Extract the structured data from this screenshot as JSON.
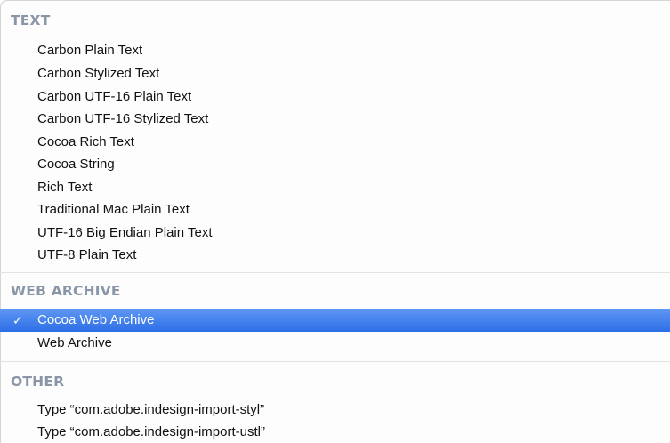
{
  "sections": [
    {
      "header": "TEXT",
      "items": [
        "Carbon Plain Text",
        "Carbon Stylized Text",
        "Carbon UTF-16 Plain Text",
        "Carbon UTF-16 Stylized Text",
        "Cocoa Rich Text",
        "Cocoa String",
        "Rich Text",
        "Traditional Mac Plain Text",
        "UTF-16 Big Endian Plain Text",
        "UTF-8 Plain Text"
      ]
    },
    {
      "header": "WEB ARCHIVE",
      "items": [
        "Cocoa Web Archive",
        "Web Archive"
      ],
      "selected_item": "Cocoa Web Archive"
    },
    {
      "header": "OTHER",
      "items": [
        "Type “com.adobe.indesign-import-styl”",
        "Type “com.adobe.indesign-import-ustl”"
      ]
    }
  ],
  "checkmark": "✓",
  "colors": {
    "section_header": "#8a96a8",
    "selection": "#2f70e8",
    "selected_text": "#ffffff"
  }
}
